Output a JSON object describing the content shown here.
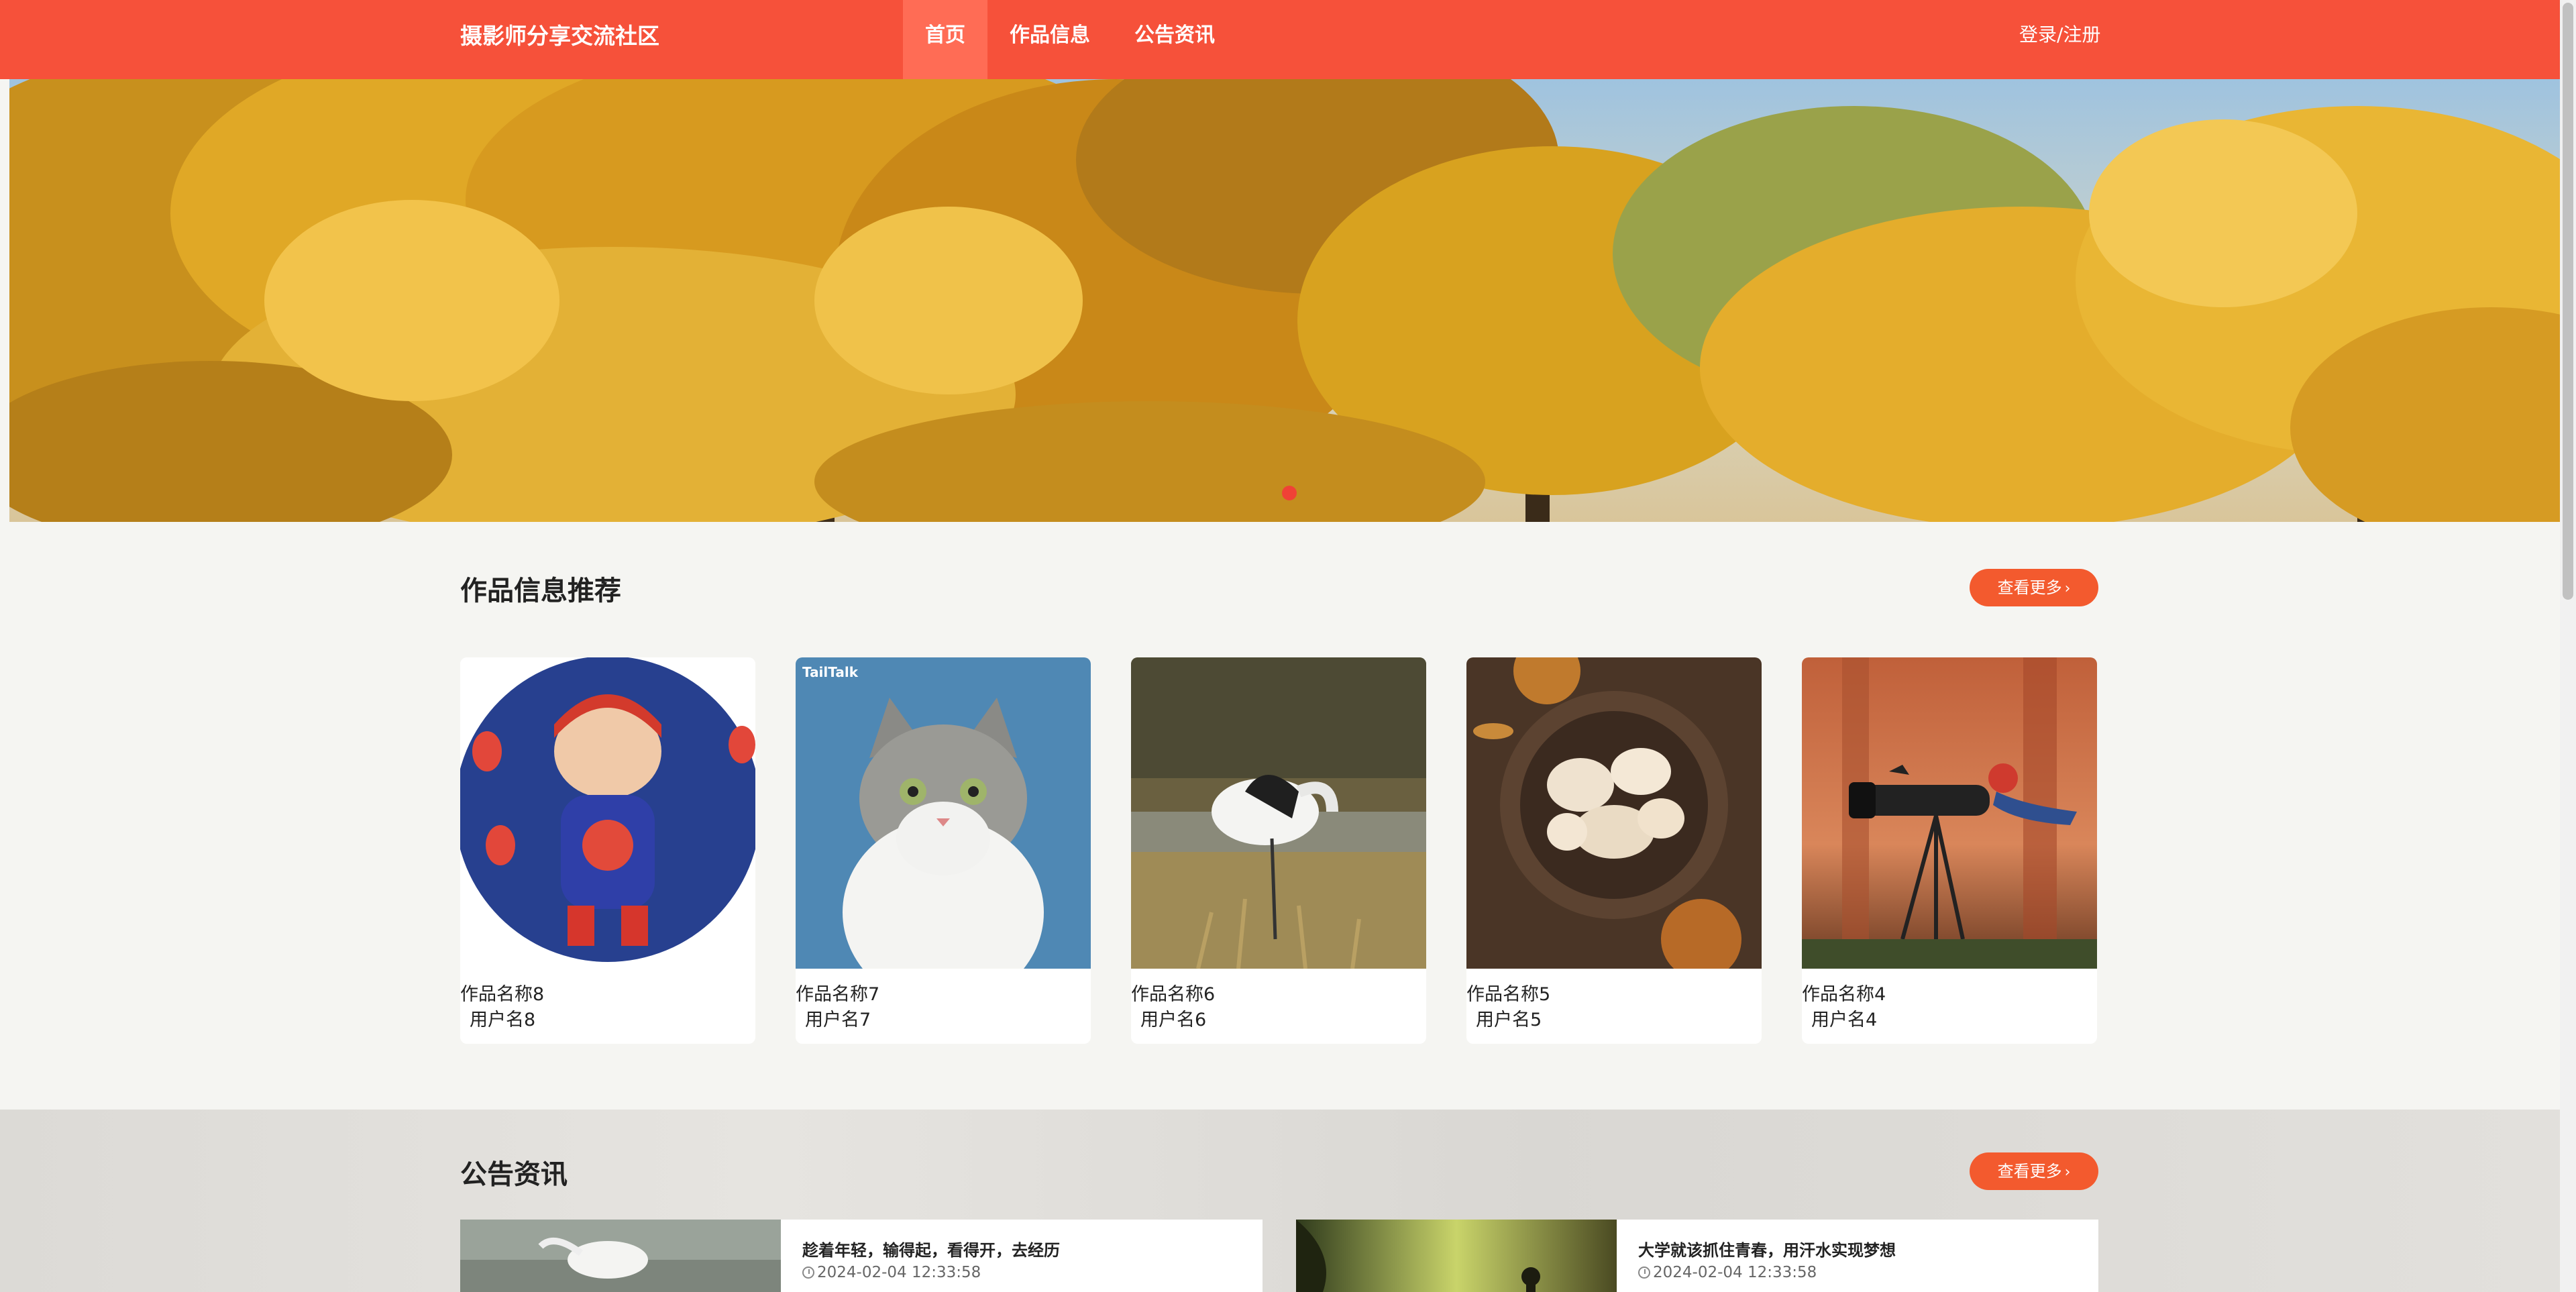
{
  "header": {
    "brand": "摄影师分享交流社区",
    "nav": [
      "首页",
      "作品信息",
      "公告资讯"
    ],
    "login": "登录/注册"
  },
  "works": {
    "title": "作品信息推荐",
    "more": "查看更多",
    "items": [
      {
        "name": "作品名称8",
        "user": "用户名8"
      },
      {
        "name": "作品名称7",
        "user": "用户名7",
        "watermark": "TailTalk"
      },
      {
        "name": "作品名称6",
        "user": "用户名6"
      },
      {
        "name": "作品名称5",
        "user": "用户名5"
      },
      {
        "name": "作品名称4",
        "user": "用户名4"
      }
    ]
  },
  "news": {
    "title": "公告资讯",
    "more": "查看更多",
    "items": [
      {
        "title": "趁着年轻，输得起，看得开，去经历",
        "time": "2024-02-04 12:33:58"
      },
      {
        "title": "大学就该抓住青春，用汗水实现梦想",
        "time": "2024-02-04 12:33:58"
      }
    ]
  },
  "colors": {
    "primary": "#f6513a",
    "button": "#f35a2e",
    "background": "#f5f5f2"
  }
}
